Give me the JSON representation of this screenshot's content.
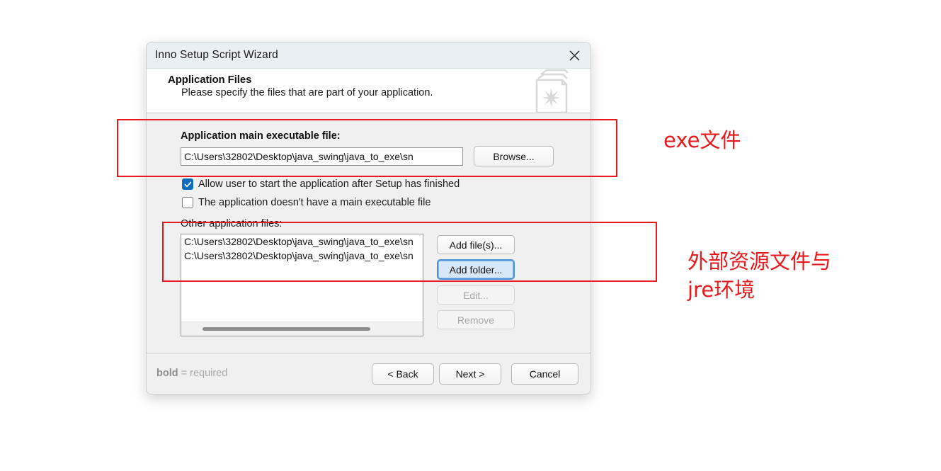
{
  "window": {
    "title": "Inno Setup Script Wizard",
    "close_icon": "close-icon"
  },
  "header": {
    "title": "Application Files",
    "subtitle": "Please specify the files that are part of your application.",
    "icon": "documents-star-icon"
  },
  "main_executable": {
    "label": "Application main executable file:",
    "path_value": "C:\\Users\\32802\\Desktop\\java_swing\\java_to_exe\\sn",
    "browse_label": "Browse..."
  },
  "checkboxes": [
    {
      "label": "Allow user to start the application after Setup has finished",
      "checked": true
    },
    {
      "label": "The application doesn't have a main executable file",
      "checked": false
    }
  ],
  "other_files": {
    "label": "Other application files:",
    "items": [
      "C:\\Users\\32802\\Desktop\\java_swing\\java_to_exe\\sn",
      "C:\\Users\\32802\\Desktop\\java_swing\\java_to_exe\\sn"
    ],
    "buttons": [
      {
        "label": "Add file(s)...",
        "state": "normal"
      },
      {
        "label": "Add folder...",
        "state": "focused"
      },
      {
        "label": "Edit...",
        "state": "disabled"
      },
      {
        "label": "Remove",
        "state": "disabled"
      }
    ]
  },
  "footer": {
    "note_bold": "bold",
    "note_rest": " = required",
    "buttons": [
      {
        "label": "< Back"
      },
      {
        "label": "Next >"
      },
      {
        "label": "Cancel"
      }
    ]
  },
  "annotations": {
    "color": "#e8191b",
    "exe_note": "exe文件",
    "resources_note_line1": "外部资源文件与",
    "resources_note_line2": "jre环境"
  }
}
